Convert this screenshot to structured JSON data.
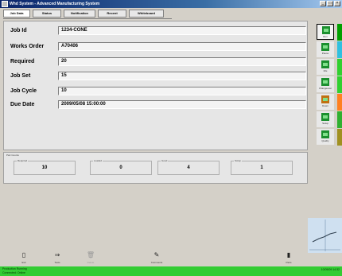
{
  "window": {
    "title": "Whd System - Advanced Manufacturing System"
  },
  "tabs": [
    {
      "label": "Job Data"
    },
    {
      "label": "Status"
    },
    {
      "label": "Notification"
    },
    {
      "label": "Recent"
    },
    {
      "label": "Whiteboard"
    }
  ],
  "fields": [
    {
      "label": "Job Id",
      "value": "1234-CONE"
    },
    {
      "label": "Works Order",
      "value": "A70406"
    },
    {
      "label": "Required",
      "value": "20"
    },
    {
      "label": "Job Set",
      "value": "15"
    },
    {
      "label": "Job Cycle",
      "value": "10"
    },
    {
      "label": "Due Date",
      "value": "2009/05/08 15:00:00"
    }
  ],
  "counters": {
    "section_label": "Part Counts",
    "items": [
      {
        "label": "Required",
        "value": "10"
      },
      {
        "label": "Loaded",
        "value": "0"
      },
      {
        "label": "Good",
        "value": "4"
      },
      {
        "label": "Scrap",
        "value": "1"
      }
    ]
  },
  "right_bar": {
    "items": [
      {
        "label": "Run",
        "icon": "machine-run-icon",
        "stripe": "#00a000"
      },
      {
        "label": "Pause",
        "icon": "machine-pause-icon",
        "stripe": "#30c0e0"
      },
      {
        "label": "Idle",
        "icon": "machine-idle-icon",
        "stripe": "#30d030"
      },
      {
        "label": "Changeover",
        "icon": "machine-changeover-icon",
        "stripe": "#30d030"
      },
      {
        "label": "Down",
        "icon": "machine-down-icon",
        "stripe": "#ff8020"
      },
      {
        "label": "Setup",
        "icon": "machine-setup-icon",
        "stripe": "#30b030"
      },
      {
        "label": "Quality",
        "icon": "machine-quality-icon",
        "stripe": "#a09020"
      }
    ]
  },
  "toolbar": {
    "items": [
      {
        "label": "Exit",
        "icon": "exit-icon",
        "glyph": "▯",
        "enabled": true
      },
      {
        "label": "Tools",
        "icon": "tools-icon",
        "glyph": "⇒",
        "enabled": true
      },
      {
        "label": "Delete",
        "icon": "delete-icon",
        "glyph": "🗑",
        "enabled": false
      },
      {
        "label": "Comments",
        "icon": "comments-icon",
        "glyph": "✎",
        "enabled": true
      },
      {
        "label": "Parts",
        "icon": "parts-icon",
        "glyph": "▮",
        "enabled": true
      }
    ]
  },
  "status": {
    "line1": "Production Running",
    "line2": "Connected: Online",
    "right": "10/05/09 14:32"
  },
  "colors": {
    "status_bar": "#33cc33",
    "title_bar": "#0a246a"
  }
}
